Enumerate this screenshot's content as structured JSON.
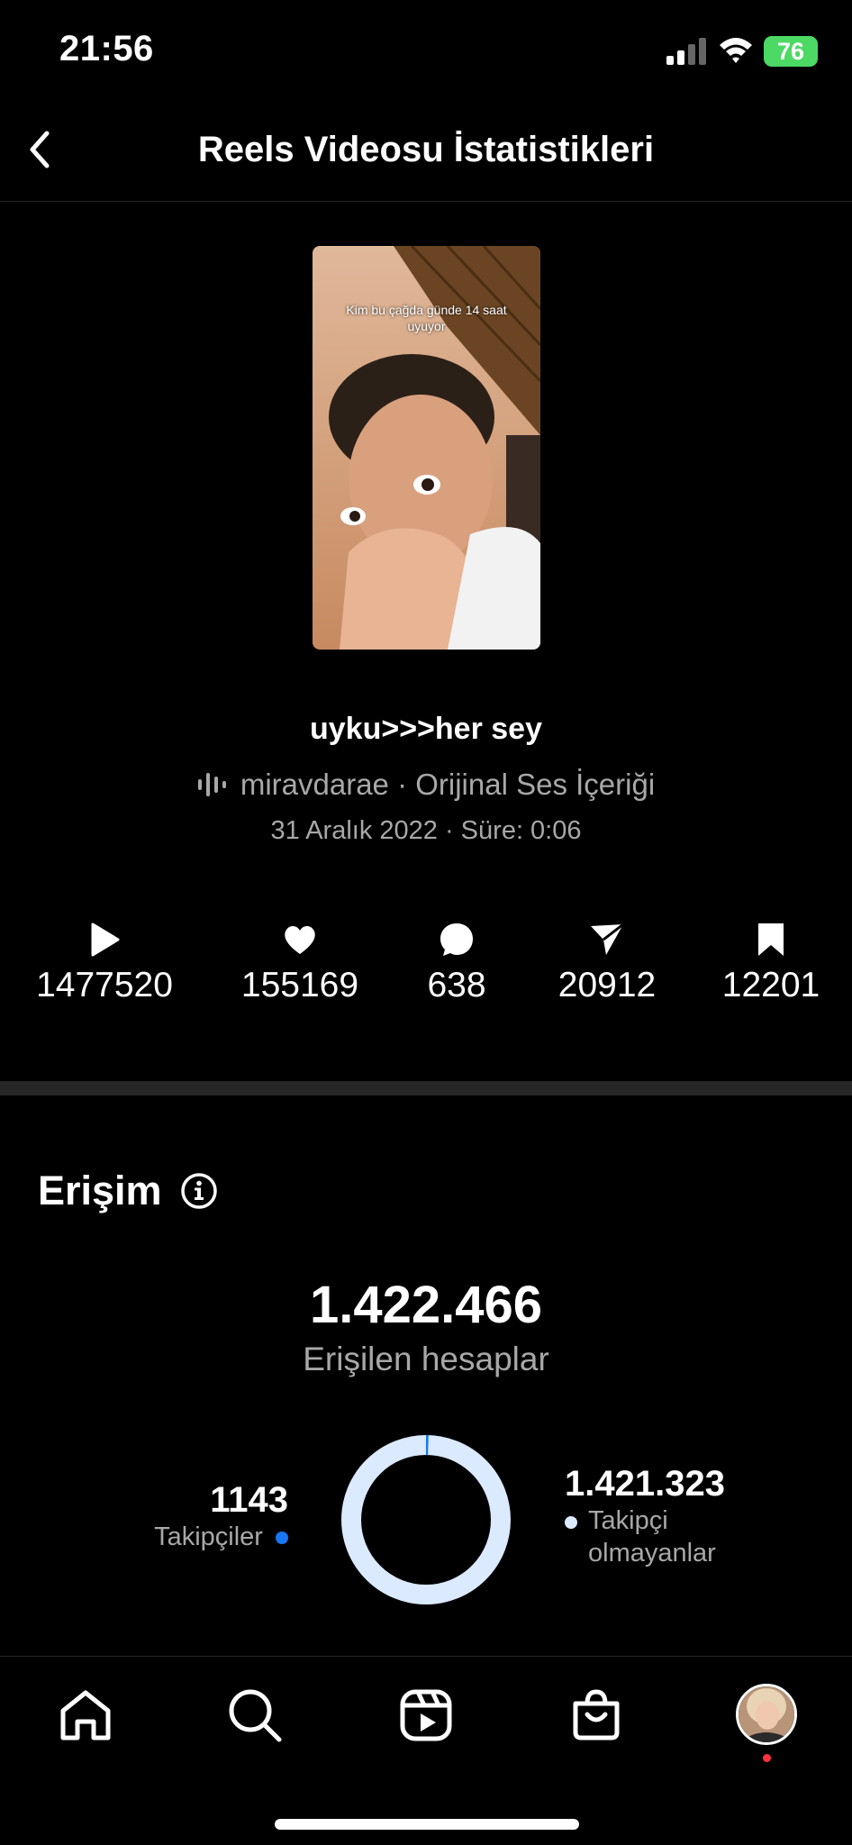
{
  "status_bar": {
    "time": "21:56",
    "battery": "76"
  },
  "nav": {
    "title": "Reels Videosu İstatistikleri"
  },
  "video": {
    "caption_overlay": "Kim bu çağda günde 14 saat uyuyor",
    "title": "uyku>>>her sey",
    "audio": "miravdarae · Orijinal Ses İçeriği",
    "date_duration": "31 Aralık 2022 · Süre: 0:06"
  },
  "stats": [
    {
      "icon": "play-icon",
      "value": "1477520"
    },
    {
      "icon": "heart-icon",
      "value": "155169"
    },
    {
      "icon": "comment-icon",
      "value": "638"
    },
    {
      "icon": "share-icon",
      "value": "20912"
    },
    {
      "icon": "bookmark-icon",
      "value": "12201"
    }
  ],
  "reach": {
    "section_title": "Erişim",
    "total": "1.422.466",
    "total_label": "Erişilen hesaplar",
    "followers_value": "1143",
    "followers_label": "Takipçiler",
    "non_followers_value": "1.421.323",
    "non_followers_label_1": "Takipçi",
    "non_followers_label_2": "olmayanlar",
    "followers_fraction": 0.0008,
    "colors": {
      "followers": "#1877f2",
      "non_followers": "#dbeafe"
    }
  },
  "tabbar": {
    "items": [
      "home-icon",
      "search-icon",
      "reels-icon",
      "shop-icon",
      "profile-avatar"
    ]
  }
}
